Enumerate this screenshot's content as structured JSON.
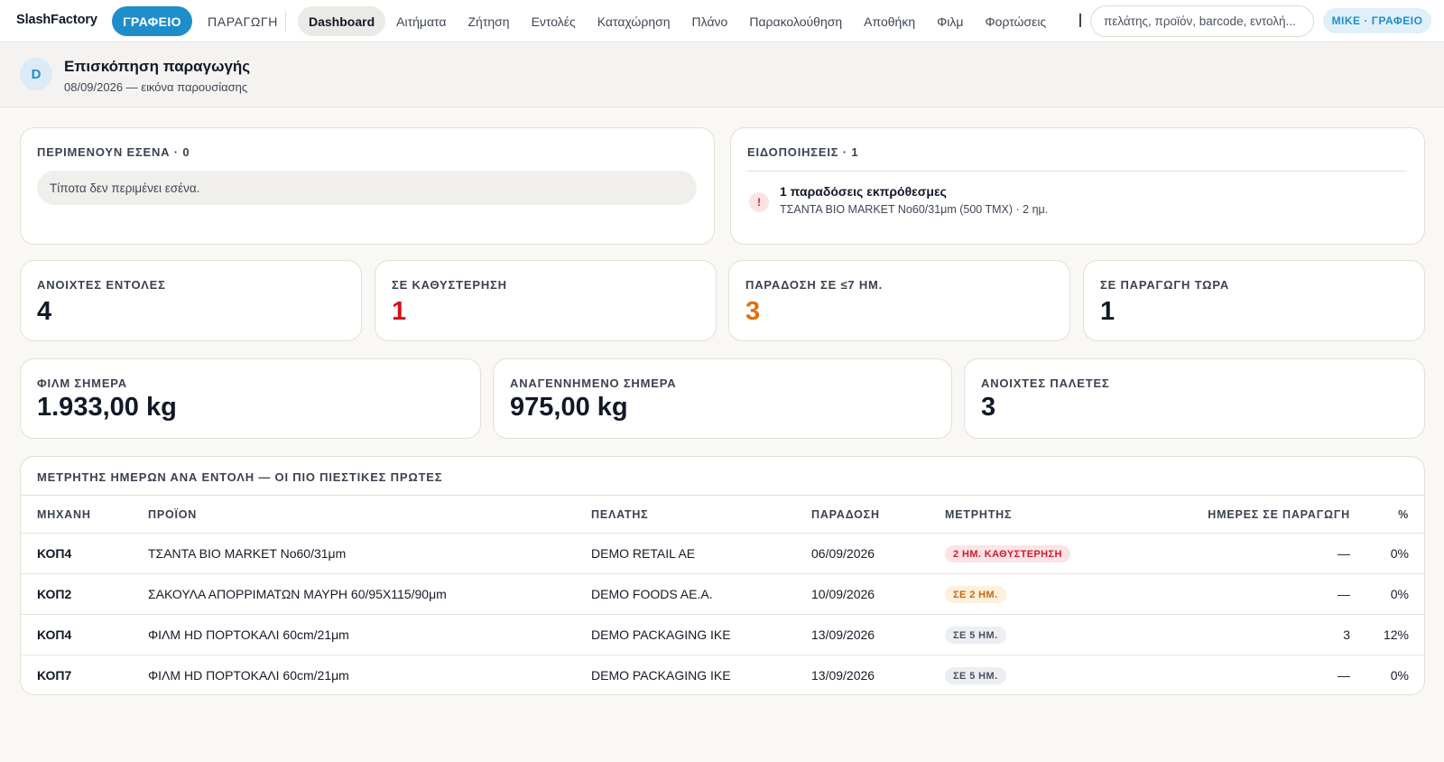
{
  "app": {
    "brand": "SlashFactory"
  },
  "modes": {
    "office": "ΓΡΑΦΕΙΟ",
    "production": "ΠΑΡΑΓΩΓΗ"
  },
  "nav": {
    "items": [
      {
        "label": "Dashboard",
        "active": true
      },
      {
        "label": "Αιτήματα"
      },
      {
        "label": "Ζήτηση"
      },
      {
        "label": "Εντολές"
      },
      {
        "label": "Καταχώρηση"
      },
      {
        "label": "Πλάνο"
      },
      {
        "label": "Παρακολούθηση"
      },
      {
        "label": "Αποθήκη"
      },
      {
        "label": "Φιλμ"
      },
      {
        "label": "Φορτώσεις"
      }
    ]
  },
  "search": {
    "placeholder": "πελάτης, προϊόν, barcode, εντολή..."
  },
  "user": {
    "badge": "MIKE · ΓΡΑΦΕΙΟ"
  },
  "header": {
    "avatar_letter": "D",
    "title": "Επισκόπηση παραγωγής",
    "subtitle": "08/09/2026 — εικόνα παρουσίασης"
  },
  "waiting": {
    "label": "ΠΕΡΙΜΕΝΟΥΝ ΕΣΕΝΑ · 0",
    "empty_text": "Τίποτα δεν περιμένει εσένα."
  },
  "notifications": {
    "label": "ΕΙΔΟΠΟΙΗΣΕΙΣ · 1",
    "items": [
      {
        "icon": "!",
        "title": "1 παραδόσεις εκπρόθεσμες",
        "detail": "ΤΣΑΝΤΑ BIO MARKET No60/31μm (500 TMX) · 2 ημ."
      }
    ]
  },
  "kpis": [
    {
      "label": "ΑΝΟΙΧΤΕΣ ΕΝΤΟΛΕΣ",
      "value": "4",
      "tone": "normal"
    },
    {
      "label": "ΣΕ ΚΑΘΥΣΤΕΡΗΣΗ",
      "value": "1",
      "tone": "red"
    },
    {
      "label": "ΠΑΡΑΔΟΣΗ ΣΕ ≤7 ΗΜ.",
      "value": "3",
      "tone": "orange"
    },
    {
      "label": "ΣΕ ΠΑΡΑΓΩΓΗ ΤΩΡΑ",
      "value": "1",
      "tone": "normal"
    }
  ],
  "kpis2": [
    {
      "label": "ΦΙΛΜ ΣΗΜΕΡΑ",
      "value": "1.933,00 kg"
    },
    {
      "label": "ΑΝΑΓΕΝΝΗΜΕΝΟ ΣΗΜΕΡΑ",
      "value": "975,00 kg"
    },
    {
      "label": "ΑΝΟΙΧΤΕΣ ΠΑΛΕΤΕΣ",
      "value": "3"
    }
  ],
  "table": {
    "title": "ΜΕΤΡΗΤΗΣ ΗΜΕΡΩΝ ΑΝΑ ΕΝΤΟΛΗ — ΟΙ ΠΙΟ ΠΙΕΣΤΙΚΕΣ ΠΡΩΤΕΣ",
    "columns": [
      "ΜΗΧΑΝΗ",
      "ΠΡΟΪΟΝ",
      "ΠΕΛΑΤΗΣ",
      "ΠΑΡΑΔΟΣΗ",
      "ΜΕΤΡΗΤΗΣ",
      "ΗΜΕΡΕΣ ΣΕ ΠΑΡΑΓΩΓΗ",
      "%"
    ],
    "rows": [
      {
        "machine": "ΚΟΠ4",
        "product": "ΤΣΑΝΤΑ BIO MARKET No60/31μm",
        "customer": "DEMO RETAIL AE",
        "delivery": "06/09/2026",
        "counter": "2 ΗΜ. ΚΑΘΥΣΤΕΡΗΣΗ",
        "counter_tone": "late",
        "days": "—",
        "percent": "0%"
      },
      {
        "machine": "ΚΟΠ2",
        "product": "ΣΑΚΟΥΛΑ ΑΠΟΡΡΙΜΑΤΩΝ ΜΑΥΡΗ 60/95X115/90μm",
        "customer": "DEMO FOODS AE.A.",
        "delivery": "10/09/2026",
        "counter": "ΣΕ 2 ΗΜ.",
        "counter_tone": "soon",
        "days": "—",
        "percent": "0%"
      },
      {
        "machine": "ΚΟΠ4",
        "product": "ΦΙΛΜ HD ΠΟΡΤΟΚΑΛΙ 60cm/21μm",
        "customer": "DEMO PACKAGING IKE",
        "delivery": "13/09/2026",
        "counter": "ΣΕ 5 ΗΜ.",
        "counter_tone": "normal",
        "days": "3",
        "percent": "12%"
      },
      {
        "machine": "ΚΟΠ7",
        "product": "ΦΙΛΜ HD ΠΟΡΤΟΚΑΛΙ 60cm/21μm",
        "customer": "DEMO PACKAGING IKE",
        "delivery": "13/09/2026",
        "counter": "ΣΕ 5 ΗΜ.",
        "counter_tone": "normal",
        "days": "—",
        "percent": "0%"
      }
    ]
  },
  "colors": {
    "accent": "#1e8ecb",
    "danger": "#d0121d",
    "warning": "#e0700e",
    "background": "#faf8f4"
  }
}
